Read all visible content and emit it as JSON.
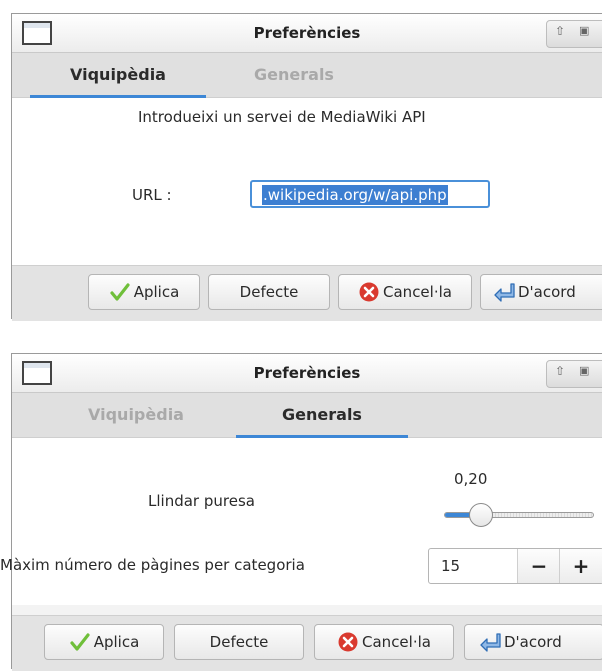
{
  "window_top": {
    "title": "Preferències",
    "tabs": [
      {
        "label": "Viquipèdia",
        "active": true
      },
      {
        "label": "Generals",
        "active": false
      }
    ],
    "intro_text": "Introdueixi un servei de MediaWiki API",
    "url_label": "URL :",
    "url_value": ".wikipedia.org/w/api.php",
    "buttons": {
      "apply": "Aplica",
      "default": "Defecte",
      "cancel": "Cancel·la",
      "ok": "D'acord"
    }
  },
  "window_bottom": {
    "title": "Preferències",
    "tabs": [
      {
        "label": "Viquipèdia",
        "active": false
      },
      {
        "label": "Generals",
        "active": true
      }
    ],
    "threshold_label": "Llindar puresa",
    "threshold_value": "0,20",
    "threshold_fraction": 0.2,
    "max_pages_label": "Màxim número de pàgines per categoria",
    "max_pages_value": "15",
    "spin_minus": "−",
    "spin_plus": "+",
    "buttons": {
      "apply": "Aplica",
      "default": "Defecte",
      "cancel": "Cancel·la",
      "ok": "D'acord"
    }
  },
  "colors": {
    "accent": "#3d87d6",
    "selection": "#3d7fd1",
    "cancel_red": "#d93a2f",
    "check_green": "#6fbf3a"
  }
}
